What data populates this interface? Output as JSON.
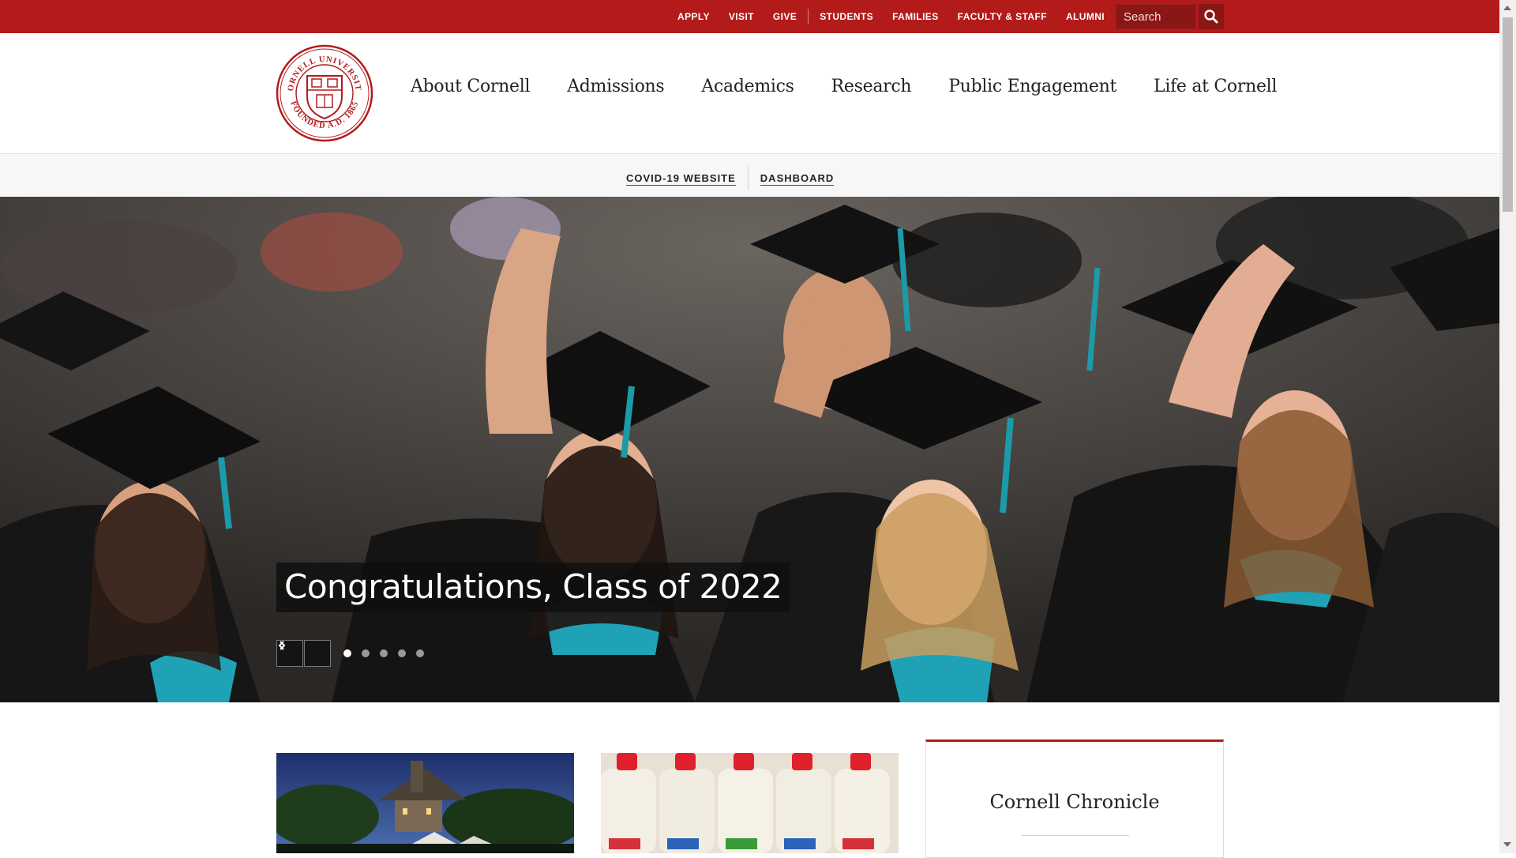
{
  "utility_nav": {
    "group1": [
      "APPLY",
      "VISIT",
      "GIVE"
    ],
    "group2": [
      "STUDENTS",
      "FAMILIES",
      "FACULTY & STAFF",
      "ALUMNI"
    ],
    "search_placeholder": "Search",
    "search_icon": "magnifier-icon"
  },
  "header": {
    "seal_text_top": "CORNELL UNIVERSITY",
    "seal_text_bottom": "FOUNDED A.D. 1865",
    "nav": [
      "About Cornell",
      "Admissions",
      "Academics",
      "Research",
      "Public Engagement",
      "Life at Cornell"
    ]
  },
  "sub_links": [
    "COVID-19 WEBSITE",
    "DASHBOARD"
  ],
  "hero": {
    "caption": "Congratulations, Class of 2022",
    "prev_icon": "chevron-left-icon",
    "next_icon": "chevron-right-icon",
    "slide_count": 5,
    "active_slide": 1
  },
  "cards": {
    "chronicle_title": "Cornell Chronicle"
  },
  "colors": {
    "brand_red": "#b31b1b"
  }
}
